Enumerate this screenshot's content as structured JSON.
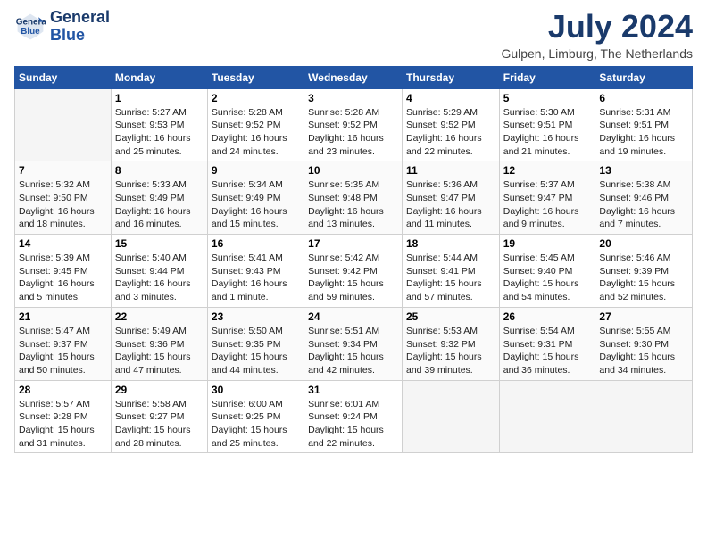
{
  "header": {
    "logo_line1": "General",
    "logo_line2": "Blue",
    "month_title": "July 2024",
    "location": "Gulpen, Limburg, The Netherlands"
  },
  "days_of_week": [
    "Sunday",
    "Monday",
    "Tuesday",
    "Wednesday",
    "Thursday",
    "Friday",
    "Saturday"
  ],
  "weeks": [
    [
      {
        "num": "",
        "sunrise": "",
        "sunset": "",
        "daylight": ""
      },
      {
        "num": "1",
        "sunrise": "Sunrise: 5:27 AM",
        "sunset": "Sunset: 9:53 PM",
        "daylight": "Daylight: 16 hours and 25 minutes."
      },
      {
        "num": "2",
        "sunrise": "Sunrise: 5:28 AM",
        "sunset": "Sunset: 9:52 PM",
        "daylight": "Daylight: 16 hours and 24 minutes."
      },
      {
        "num": "3",
        "sunrise": "Sunrise: 5:28 AM",
        "sunset": "Sunset: 9:52 PM",
        "daylight": "Daylight: 16 hours and 23 minutes."
      },
      {
        "num": "4",
        "sunrise": "Sunrise: 5:29 AM",
        "sunset": "Sunset: 9:52 PM",
        "daylight": "Daylight: 16 hours and 22 minutes."
      },
      {
        "num": "5",
        "sunrise": "Sunrise: 5:30 AM",
        "sunset": "Sunset: 9:51 PM",
        "daylight": "Daylight: 16 hours and 21 minutes."
      },
      {
        "num": "6",
        "sunrise": "Sunrise: 5:31 AM",
        "sunset": "Sunset: 9:51 PM",
        "daylight": "Daylight: 16 hours and 19 minutes."
      }
    ],
    [
      {
        "num": "7",
        "sunrise": "Sunrise: 5:32 AM",
        "sunset": "Sunset: 9:50 PM",
        "daylight": "Daylight: 16 hours and 18 minutes."
      },
      {
        "num": "8",
        "sunrise": "Sunrise: 5:33 AM",
        "sunset": "Sunset: 9:49 PM",
        "daylight": "Daylight: 16 hours and 16 minutes."
      },
      {
        "num": "9",
        "sunrise": "Sunrise: 5:34 AM",
        "sunset": "Sunset: 9:49 PM",
        "daylight": "Daylight: 16 hours and 15 minutes."
      },
      {
        "num": "10",
        "sunrise": "Sunrise: 5:35 AM",
        "sunset": "Sunset: 9:48 PM",
        "daylight": "Daylight: 16 hours and 13 minutes."
      },
      {
        "num": "11",
        "sunrise": "Sunrise: 5:36 AM",
        "sunset": "Sunset: 9:47 PM",
        "daylight": "Daylight: 16 hours and 11 minutes."
      },
      {
        "num": "12",
        "sunrise": "Sunrise: 5:37 AM",
        "sunset": "Sunset: 9:47 PM",
        "daylight": "Daylight: 16 hours and 9 minutes."
      },
      {
        "num": "13",
        "sunrise": "Sunrise: 5:38 AM",
        "sunset": "Sunset: 9:46 PM",
        "daylight": "Daylight: 16 hours and 7 minutes."
      }
    ],
    [
      {
        "num": "14",
        "sunrise": "Sunrise: 5:39 AM",
        "sunset": "Sunset: 9:45 PM",
        "daylight": "Daylight: 16 hours and 5 minutes."
      },
      {
        "num": "15",
        "sunrise": "Sunrise: 5:40 AM",
        "sunset": "Sunset: 9:44 PM",
        "daylight": "Daylight: 16 hours and 3 minutes."
      },
      {
        "num": "16",
        "sunrise": "Sunrise: 5:41 AM",
        "sunset": "Sunset: 9:43 PM",
        "daylight": "Daylight: 16 hours and 1 minute."
      },
      {
        "num": "17",
        "sunrise": "Sunrise: 5:42 AM",
        "sunset": "Sunset: 9:42 PM",
        "daylight": "Daylight: 15 hours and 59 minutes."
      },
      {
        "num": "18",
        "sunrise": "Sunrise: 5:44 AM",
        "sunset": "Sunset: 9:41 PM",
        "daylight": "Daylight: 15 hours and 57 minutes."
      },
      {
        "num": "19",
        "sunrise": "Sunrise: 5:45 AM",
        "sunset": "Sunset: 9:40 PM",
        "daylight": "Daylight: 15 hours and 54 minutes."
      },
      {
        "num": "20",
        "sunrise": "Sunrise: 5:46 AM",
        "sunset": "Sunset: 9:39 PM",
        "daylight": "Daylight: 15 hours and 52 minutes."
      }
    ],
    [
      {
        "num": "21",
        "sunrise": "Sunrise: 5:47 AM",
        "sunset": "Sunset: 9:37 PM",
        "daylight": "Daylight: 15 hours and 50 minutes."
      },
      {
        "num": "22",
        "sunrise": "Sunrise: 5:49 AM",
        "sunset": "Sunset: 9:36 PM",
        "daylight": "Daylight: 15 hours and 47 minutes."
      },
      {
        "num": "23",
        "sunrise": "Sunrise: 5:50 AM",
        "sunset": "Sunset: 9:35 PM",
        "daylight": "Daylight: 15 hours and 44 minutes."
      },
      {
        "num": "24",
        "sunrise": "Sunrise: 5:51 AM",
        "sunset": "Sunset: 9:34 PM",
        "daylight": "Daylight: 15 hours and 42 minutes."
      },
      {
        "num": "25",
        "sunrise": "Sunrise: 5:53 AM",
        "sunset": "Sunset: 9:32 PM",
        "daylight": "Daylight: 15 hours and 39 minutes."
      },
      {
        "num": "26",
        "sunrise": "Sunrise: 5:54 AM",
        "sunset": "Sunset: 9:31 PM",
        "daylight": "Daylight: 15 hours and 36 minutes."
      },
      {
        "num": "27",
        "sunrise": "Sunrise: 5:55 AM",
        "sunset": "Sunset: 9:30 PM",
        "daylight": "Daylight: 15 hours and 34 minutes."
      }
    ],
    [
      {
        "num": "28",
        "sunrise": "Sunrise: 5:57 AM",
        "sunset": "Sunset: 9:28 PM",
        "daylight": "Daylight: 15 hours and 31 minutes."
      },
      {
        "num": "29",
        "sunrise": "Sunrise: 5:58 AM",
        "sunset": "Sunset: 9:27 PM",
        "daylight": "Daylight: 15 hours and 28 minutes."
      },
      {
        "num": "30",
        "sunrise": "Sunrise: 6:00 AM",
        "sunset": "Sunset: 9:25 PM",
        "daylight": "Daylight: 15 hours and 25 minutes."
      },
      {
        "num": "31",
        "sunrise": "Sunrise: 6:01 AM",
        "sunset": "Sunset: 9:24 PM",
        "daylight": "Daylight: 15 hours and 22 minutes."
      },
      {
        "num": "",
        "sunrise": "",
        "sunset": "",
        "daylight": ""
      },
      {
        "num": "",
        "sunrise": "",
        "sunset": "",
        "daylight": ""
      },
      {
        "num": "",
        "sunrise": "",
        "sunset": "",
        "daylight": ""
      }
    ]
  ]
}
